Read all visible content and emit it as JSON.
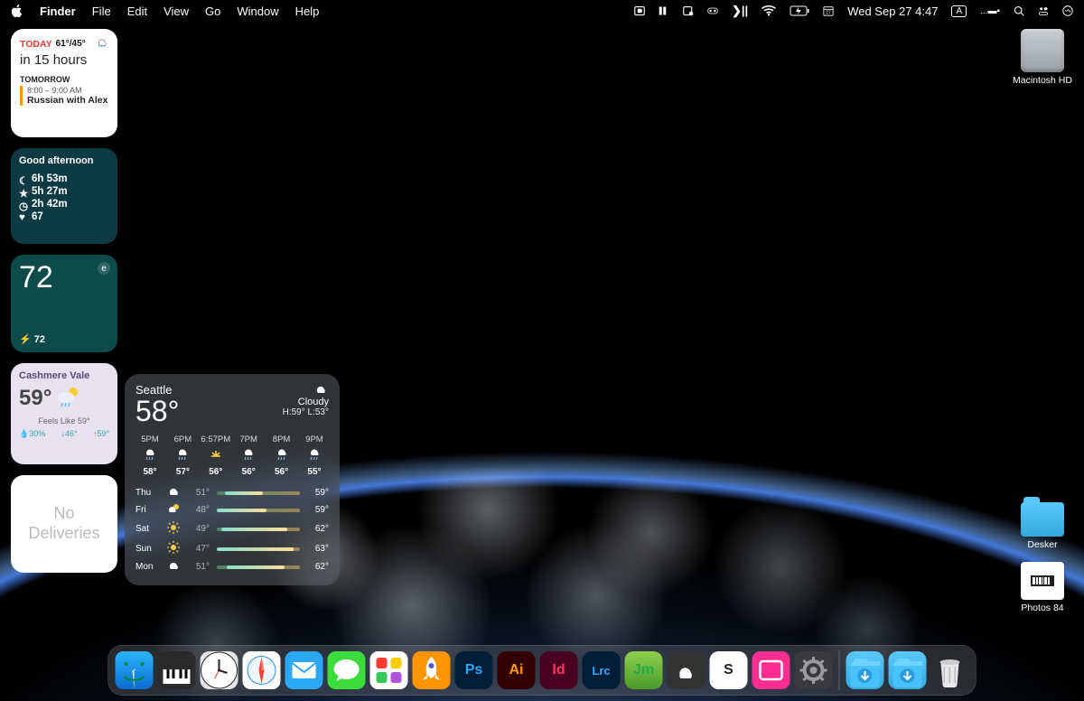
{
  "menubar": {
    "app": "Finder",
    "items": [
      "File",
      "Edit",
      "View",
      "Go",
      "Window",
      "Help"
    ],
    "datetime": "Wed Sep 27  4:47",
    "input_mode": "A"
  },
  "widgets": {
    "calendar": {
      "today_label": "TODAY",
      "temps": "61°/45°",
      "in_hours": "in 15 hours",
      "tomorrow_label": "TOMORROW",
      "event_time": "8:00 – 9:00 AM",
      "event_title": "Russian with Alex"
    },
    "afternoon": {
      "title": "Good afternoon",
      "rows": [
        {
          "icon": "moon",
          "text": "6h 53m"
        },
        {
          "icon": "star",
          "text": "5h 27m"
        },
        {
          "icon": "clock",
          "text": "2h 42m"
        },
        {
          "icon": "heart",
          "text": "67"
        }
      ]
    },
    "number": {
      "big": "72",
      "corner": "e",
      "bottom_icon": "bolt",
      "bottom": "72"
    },
    "cashmere": {
      "location": "Cashmere Vale",
      "temp": "59°",
      "feels": "Feels Like  59°",
      "humidity": "30%",
      "low": "46°",
      "high": "59°"
    },
    "deliveries": {
      "line1": "No",
      "line2": "Deliveries"
    },
    "seattle": {
      "city": "Seattle",
      "temp": "58°",
      "cond": "Cloudy",
      "hilo": "H:59° L:53°",
      "hourly": [
        {
          "lbl": "5PM",
          "icon": "rain",
          "tmp": "58°"
        },
        {
          "lbl": "6PM",
          "icon": "rain",
          "tmp": "57°"
        },
        {
          "lbl": "6:57PM",
          "icon": "sunset",
          "tmp": "56°"
        },
        {
          "lbl": "7PM",
          "icon": "rain",
          "tmp": "56°"
        },
        {
          "lbl": "8PM",
          "icon": "rain",
          "tmp": "56°"
        },
        {
          "lbl": "9PM",
          "icon": "rain",
          "tmp": "55°"
        }
      ],
      "daily": [
        {
          "d": "Thu",
          "icon": "cloud",
          "lo": "51°",
          "hi": "59°",
          "s": 10,
          "e": 55
        },
        {
          "d": "Fri",
          "icon": "partly",
          "lo": "48°",
          "hi": "59°",
          "s": 0,
          "e": 60
        },
        {
          "d": "Sat",
          "icon": "sun",
          "lo": "49°",
          "hi": "62°",
          "s": 5,
          "e": 85
        },
        {
          "d": "Sun",
          "icon": "sun",
          "lo": "47°",
          "hi": "63°",
          "s": 0,
          "e": 92
        },
        {
          "d": "Mon",
          "icon": "cloud",
          "lo": "51°",
          "hi": "62°",
          "s": 12,
          "e": 82
        }
      ]
    }
  },
  "desktop": {
    "hd": "Macintosh HD",
    "folder": "Desker",
    "photos": "Photos 84"
  },
  "dock": [
    {
      "name": "finder",
      "bg": "linear-gradient(#2aa8f5,#0b6fd6)",
      "glyph": "finder"
    },
    {
      "name": "music-app",
      "bg": "linear-gradient(#4a4a4a,#222)",
      "glyph": "piano"
    },
    {
      "name": "clock",
      "bg": "radial-gradient(circle,#fff,#ddd)",
      "glyph": "clock"
    },
    {
      "name": "safari",
      "bg": "linear-gradient(#34baf8,#0a6dd8)",
      "glyph": "compass"
    },
    {
      "name": "mail",
      "bg": "linear-gradient(#3cc3ff,#1e74f0)",
      "glyph": "mail"
    },
    {
      "name": "messages",
      "bg": "linear-gradient(#6fe66f,#2bb32b)",
      "glyph": "bubble"
    },
    {
      "name": "colorful",
      "bg": "#fff",
      "glyph": "grid"
    },
    {
      "name": "rocket",
      "bg": "linear-gradient(#ffb238,#ff7a18)",
      "glyph": "rocket"
    },
    {
      "name": "photoshop",
      "bg": "#001e36",
      "glyph": "Ps",
      "fg": "#31a8ff"
    },
    {
      "name": "illustrator",
      "bg": "#330000",
      "glyph": "Ai",
      "fg": "#ff9a00"
    },
    {
      "name": "indesign",
      "bg": "#49021f",
      "glyph": "Id",
      "fg": "#ff3366"
    },
    {
      "name": "lightroom",
      "bg": "#001e36",
      "glyph": "Lrc",
      "fg": "#31a8ff"
    },
    {
      "name": "jm",
      "bg": "linear-gradient(#8fd14f,#4a9a2a)",
      "glyph": "Jm",
      "fg": "#2a4"
    },
    {
      "name": "cloud",
      "bg": "linear-gradient(#555,#222)",
      "glyph": "cloud"
    },
    {
      "name": "s-app",
      "bg": "#fff",
      "glyph": "S",
      "fg": "#222"
    },
    {
      "name": "media",
      "bg": "linear-gradient(#ff4da6,#cc0066)",
      "glyph": "rect"
    },
    {
      "name": "settings",
      "bg": "linear-gradient(#555,#222)",
      "glyph": "gear"
    }
  ],
  "dock_right": [
    {
      "name": "downloads",
      "bg": "linear-gradient(#5ac8fa,#34aadc)",
      "glyph": "arrow-down"
    },
    {
      "name": "folder2",
      "bg": "linear-gradient(#5ac8fa,#34aadc)",
      "glyph": "arrow-down"
    },
    {
      "name": "trash",
      "bg": "transparent",
      "glyph": "trash"
    }
  ]
}
